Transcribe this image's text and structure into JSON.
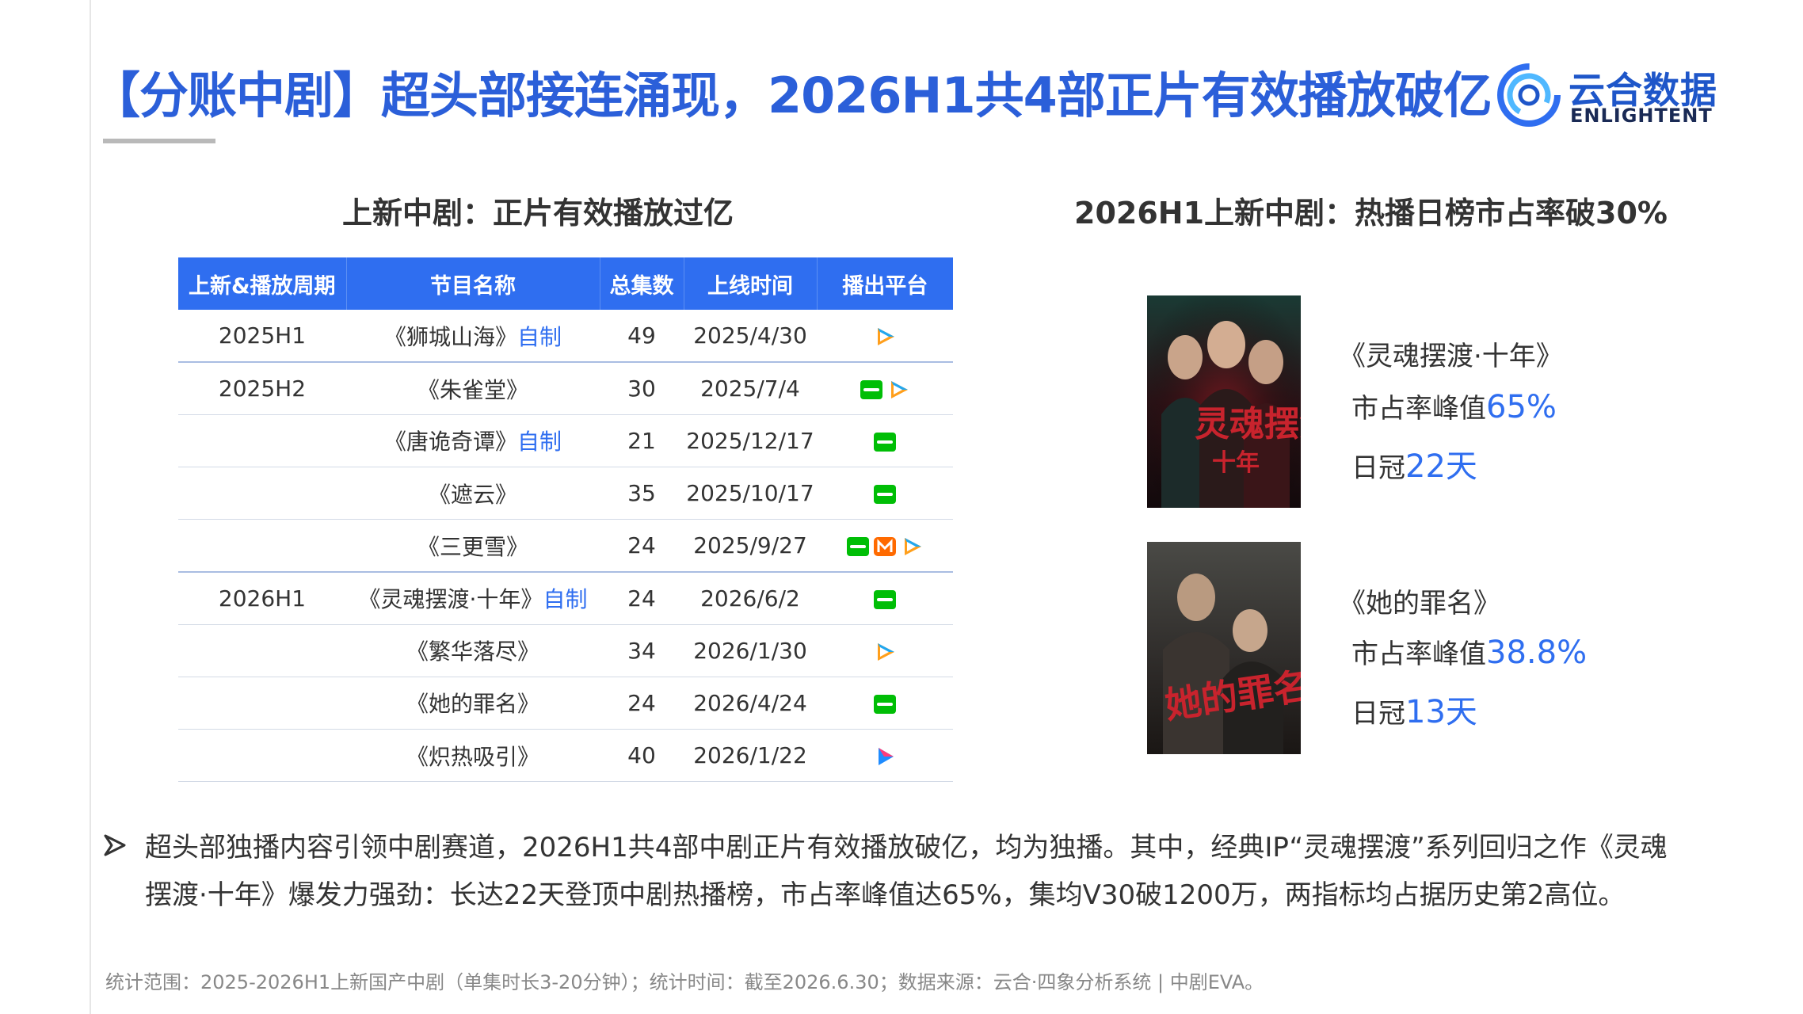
{
  "header": {
    "title": "【分账中剧】超头部接连涌现，2026H1共4部正片有效播放破亿",
    "logo": {
      "cn": "云合数据",
      "en": "ENLIGHTENT"
    }
  },
  "left_section": {
    "title": "上新中剧：正片有效播放过亿",
    "table": {
      "headers": [
        "上新&播放周期",
        "节目名称",
        "总集数",
        "上线时间",
        "播出平台"
      ],
      "rows": [
        {
          "period": "2025H1",
          "name": "《狮城山海》",
          "tag": "自制",
          "eps": "49",
          "date": "2025/4/30",
          "platforms": [
            "tencent"
          ]
        },
        {
          "period": "2025H2",
          "name": "《朱雀堂》",
          "tag": "",
          "eps": "30",
          "date": "2025/7/4",
          "platforms": [
            "iqiyi",
            "tencent"
          ]
        },
        {
          "period": "",
          "name": "《唐诡奇谭》",
          "tag": "自制",
          "eps": "21",
          "date": "2025/12/17",
          "platforms": [
            "iqiyi"
          ]
        },
        {
          "period": "",
          "name": "《遮云》",
          "tag": "",
          "eps": "35",
          "date": "2025/10/17",
          "platforms": [
            "iqiyi"
          ]
        },
        {
          "period": "",
          "name": "《三更雪》",
          "tag": "",
          "eps": "24",
          "date": "2025/9/27",
          "platforms": [
            "iqiyi",
            "mgtv",
            "tencent"
          ]
        },
        {
          "period": "2026H1",
          "name": "《灵魂摆渡·十年》",
          "tag": "自制",
          "eps": "24",
          "date": "2026/6/2",
          "platforms": [
            "iqiyi"
          ]
        },
        {
          "period": "",
          "name": "《繁华落尽》",
          "tag": "",
          "eps": "34",
          "date": "2026/1/30",
          "platforms": [
            "tencent"
          ]
        },
        {
          "period": "",
          "name": "《她的罪名》",
          "tag": "",
          "eps": "24",
          "date": "2026/4/24",
          "platforms": [
            "iqiyi"
          ]
        },
        {
          "period": "",
          "name": "《炽热吸引》",
          "tag": "",
          "eps": "40",
          "date": "2026/1/22",
          "platforms": [
            "youku"
          ]
        }
      ]
    }
  },
  "right_section": {
    "title": "2026H1上新中剧：热播日榜市占率破30%",
    "items": [
      {
        "poster_title": "灵魂摆渡",
        "poster_sub": "十年",
        "title": "《灵魂摆渡·十年》",
        "share_label": "市占率峰值",
        "share_value": "65%",
        "crown_label": "日冠",
        "crown_value": "22天"
      },
      {
        "poster_title": "她的罪名",
        "title": "《她的罪名》",
        "share_label": "市占率峰值",
        "share_value": "38.8%",
        "crown_label": "日冠",
        "crown_value": "13天"
      }
    ]
  },
  "bullet": {
    "text": "超头部独播内容引领中剧赛道，2026H1共4部中剧正片有效播放破亿，均为独播。其中，经典IP“灵魂摆渡”系列回归之作《灵魂摆渡·十年》爆发力强劲：长达22天登顶中剧热播榜，市占率峰值达65%，集均V30破1200万，两指标均占据历史第2高位。"
  },
  "footnote": "统计范围：2025-2026H1上新国产中剧（单集时长3-20分钟）；统计时间：截至2026.6.30；数据来源：云合·四象分析系统 | 中剧EVA。",
  "colors": {
    "accent": "#2f6ef0",
    "title": "#2b5fd9",
    "iqiyi": "#00be06",
    "mgtv": "#ff6a00"
  },
  "icons": {
    "tencent": "tencent-video-icon",
    "iqiyi": "iqiyi-icon",
    "mgtv": "mgtv-icon",
    "youku": "youku-icon"
  }
}
